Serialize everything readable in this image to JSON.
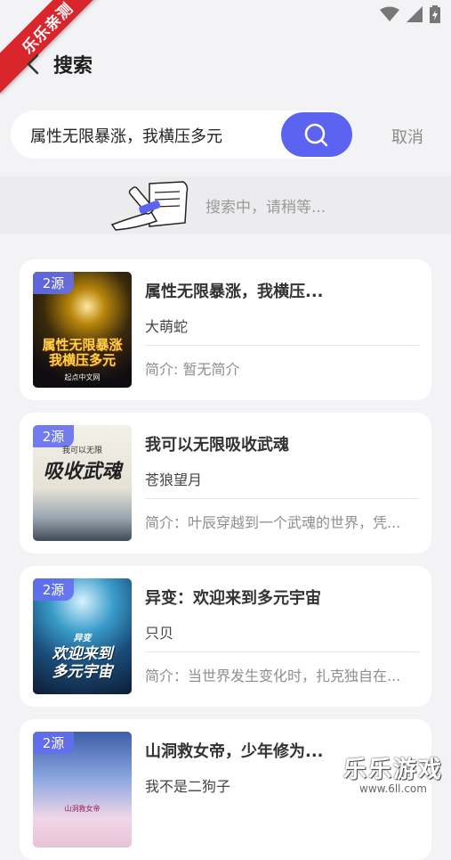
{
  "status_bar": {
    "icons": [
      "wifi-icon",
      "signal-icon",
      "battery-icon"
    ]
  },
  "ribbon": {
    "text": "乐乐亲测"
  },
  "header": {
    "back_icon": "chevron-left-icon",
    "title": "搜索"
  },
  "search": {
    "value": "属性无限暴涨，我横压多元",
    "button_icon": "search-icon",
    "cancel_label": "取消"
  },
  "loading": {
    "text": "搜索中，请稍等..."
  },
  "results": [
    {
      "badge": "2源",
      "title": "属性无限暴涨，我横压...",
      "author": "大萌蛇",
      "intro": "简介: 暂无简介",
      "cover_text": "属性无限暴涨\n我横压多元",
      "cover_small": "起点中文网"
    },
    {
      "badge": "2源",
      "title": "我可以无限吸收武魂",
      "author": "苍狼望月",
      "intro": "简介：叶辰穿越到一个武魂的世界，凭...",
      "cover_text": "吸收武魂",
      "cover_small": "我可以无限"
    },
    {
      "badge": "2源",
      "title": "异变：欢迎来到多元宇宙",
      "author": "只贝",
      "intro": "简介：当世界发生变化时，扎克独自在...",
      "cover_text": "欢迎来到\n多元宇宙",
      "cover_small": "异变"
    },
    {
      "badge": "2源",
      "title": "山洞救女帝，少年修为...",
      "author": "我不是二狗子",
      "intro": "",
      "cover_text": "",
      "cover_small": "山洞救女帝"
    }
  ],
  "watermark": {
    "main": "乐乐游戏",
    "sub": "www.6ll.com"
  },
  "colors": {
    "accent": "#5b63f0",
    "background": "#f3f3f5",
    "ribbon": "#d8262c"
  }
}
